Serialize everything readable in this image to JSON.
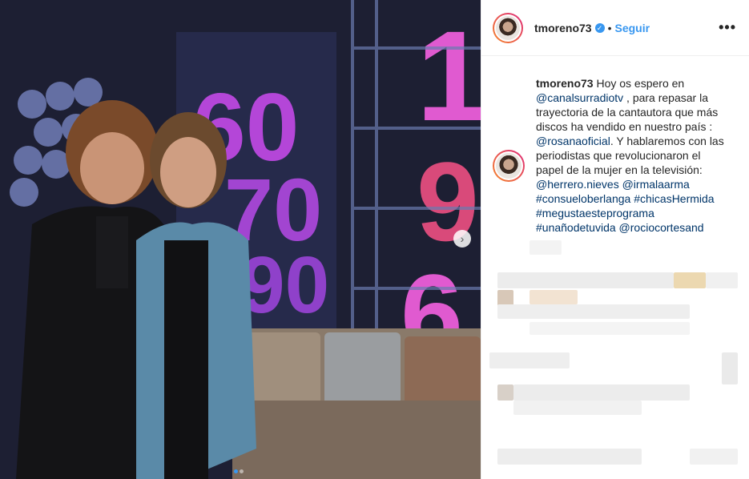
{
  "post": {
    "username": "tmoreno73",
    "verified_glyph": "✓",
    "separator": "•",
    "follow_label": "Seguir",
    "more_label": "•••",
    "caption": {
      "username": "tmoreno73",
      "text_1": " Hoy os espero en ",
      "mention_1": "@canalsurradiotv",
      "text_2": " , para repasar la trayectoria de la cantautora que más discos ha vendido en nuestro país : ",
      "mention_2": "@rosanaoficial",
      "text_3": ". Y hablaremos con las periodistas que revolucionaron el papel de la mujer en la televisión: ",
      "mention_3": "@herrero.nieves",
      "mention_4": "@irmalaarma",
      "tag_1": "#consueloberlanga",
      "tag_2": "#chicasHermida",
      "tag_3": "#megustaesteprograma",
      "tag_4": "#unañodetuvida",
      "mention_5": "@rociocortesand"
    },
    "next_glyph": "›",
    "carousel_pages": 2,
    "carousel_active": 1
  },
  "colors": {
    "accent": "#3897f0",
    "link": "#003569",
    "text": "#262626"
  },
  "icons": [
    "verified-badge-icon",
    "more-options-icon",
    "chevron-right-icon"
  ]
}
